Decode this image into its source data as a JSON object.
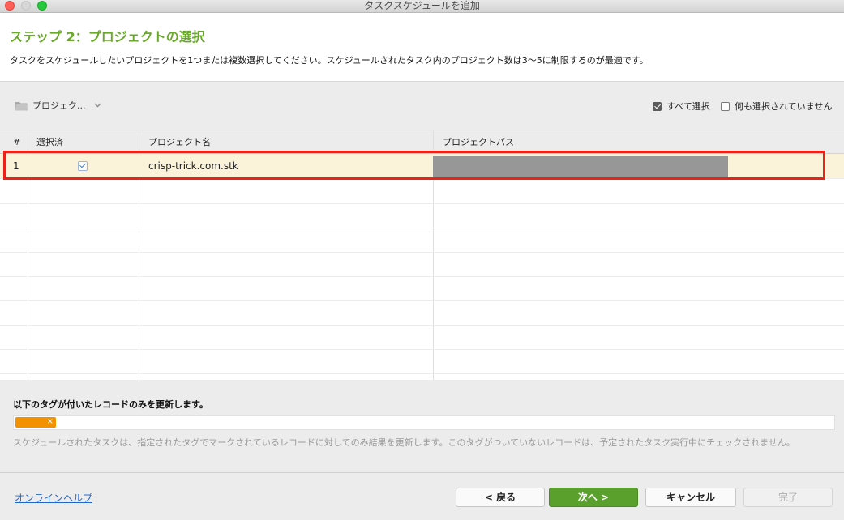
{
  "window": {
    "title": "タスクスケジュールを追加"
  },
  "header": {
    "step_title": "ステップ 2：プロジェクトの選択",
    "description": "タスクをスケジュールしたいプロジェクトを1つまたは複数選択してください。スケジュールされたタスク内のプロジェクト数は3〜5に制限するのが最適です。"
  },
  "toolbar": {
    "project_filter_label": "プロジェク...",
    "select_all_label": "すべて選択",
    "select_none_label": "何も選択されていません",
    "select_all_checked": true,
    "select_none_checked": false
  },
  "table": {
    "columns": [
      "#",
      "選択済",
      "プロジェクト名",
      "プロジェクトパス"
    ],
    "rows": [
      {
        "num": "1",
        "selected": true,
        "name": "crisp-trick.com.stk",
        "path": ""
      }
    ]
  },
  "tags": {
    "title": "以下のタグが付いたレコードのみを更新します。",
    "chip_color": "#f39200",
    "chip_close": "×",
    "note": "スケジュールされたタスクは、指定されたタグでマークされているレコードに対してのみ結果を更新します。このタグがついていないレコードは、予定されたタスク実行中にチェックされません。"
  },
  "footer": {
    "help_link": "オンラインヘルプ",
    "back_label": "< 戻る",
    "next_label": "次へ >",
    "cancel_label": "キャンセル",
    "done_label": "完了"
  },
  "colors": {
    "accent": "#6aa82c",
    "next_button": "#5aa02c",
    "selected_row": "#fbf3d9",
    "highlight_border": "#e8231c"
  }
}
